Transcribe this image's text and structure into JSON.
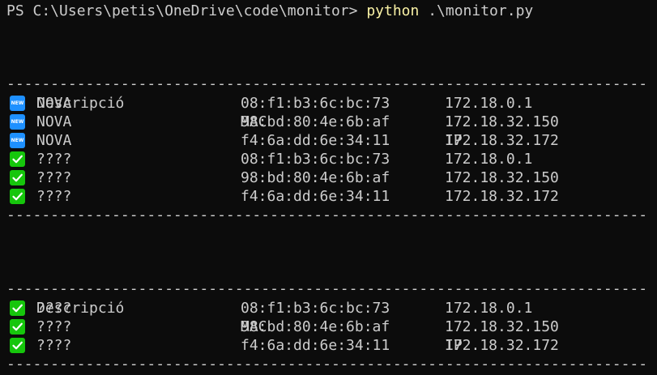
{
  "prompt": {
    "path": "PS C:\\Users\\petis\\OneDrive\\code\\monitor> ",
    "command": "python",
    "argument": " .\\monitor.py"
  },
  "columns": {
    "description": "Descripció",
    "mac": "MAC",
    "ip": "IP"
  },
  "separator": "---------------------------------------------------------------------------------------------",
  "icons": {
    "header": "power-icon",
    "new": "new-badge-icon",
    "ok": "check-mark-icon",
    "new_text": "NEW",
    "colors": {
      "new": "#1e90ff",
      "ok": "#16c60c"
    }
  },
  "table1": {
    "rows": [
      {
        "status": "new",
        "description": "NOVA",
        "mac": "08:f1:b3:6c:bc:73",
        "ip": "172.18.0.1"
      },
      {
        "status": "new",
        "description": "NOVA",
        "mac": "98:bd:80:4e:6b:af",
        "ip": "172.18.32.150"
      },
      {
        "status": "new",
        "description": "NOVA",
        "mac": "f4:6a:dd:6e:34:11",
        "ip": "172.18.32.172"
      },
      {
        "status": "ok",
        "description": "????",
        "mac": "08:f1:b3:6c:bc:73",
        "ip": "172.18.0.1"
      },
      {
        "status": "ok",
        "description": "????",
        "mac": "98:bd:80:4e:6b:af",
        "ip": "172.18.32.150"
      },
      {
        "status": "ok",
        "description": "????",
        "mac": "f4:6a:dd:6e:34:11",
        "ip": "172.18.32.172"
      }
    ]
  },
  "table2": {
    "rows": [
      {
        "status": "ok",
        "description": "????",
        "mac": "08:f1:b3:6c:bc:73",
        "ip": "172.18.0.1"
      },
      {
        "status": "ok",
        "description": "????",
        "mac": "98:bd:80:4e:6b:af",
        "ip": "172.18.32.150"
      },
      {
        "status": "ok",
        "description": "????",
        "mac": "f4:6a:dd:6e:34:11",
        "ip": "172.18.32.172"
      }
    ]
  }
}
